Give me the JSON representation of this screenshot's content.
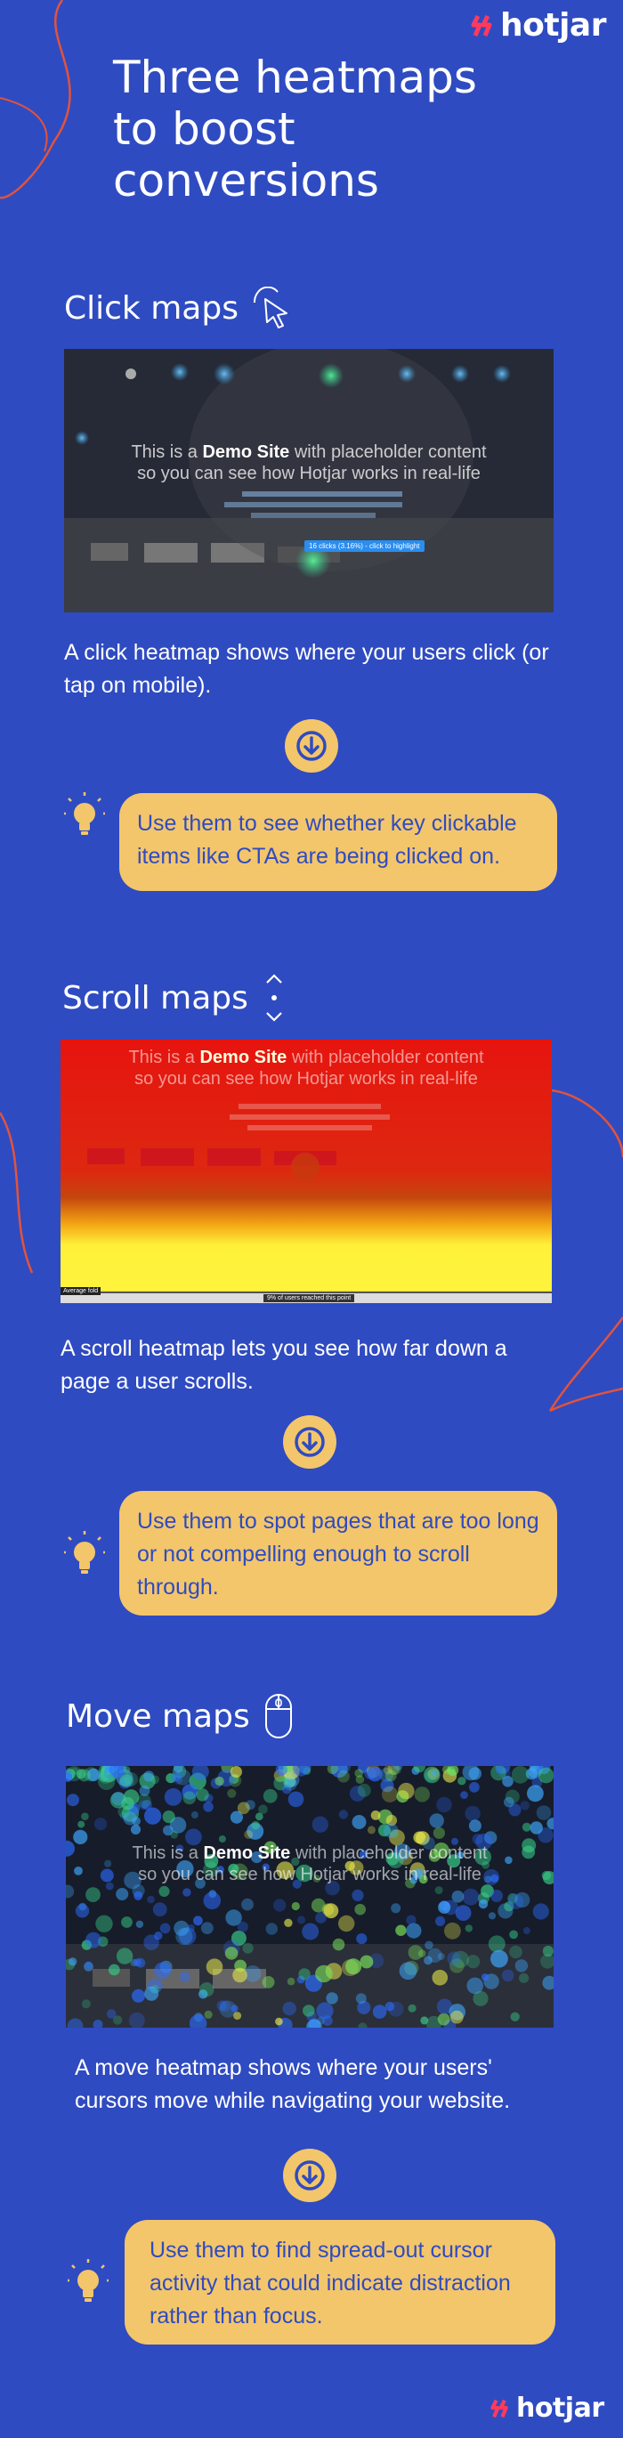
{
  "brand": {
    "name": "hotjar",
    "colors": {
      "background": "#2f4bc1",
      "accent": "#f3c66b",
      "brand": "#fd3a5c"
    }
  },
  "title": {
    "line1": "Three heatmaps",
    "line2": "to boost",
    "line3": "conversions"
  },
  "demo": {
    "prefix": "This is a ",
    "strong": "Demo Site",
    "suffix": " with placeholder content",
    "line2": "so you can see how Hotjar works in real-life"
  },
  "sections": [
    {
      "heading": "Click maps",
      "icon": "cursor-click-icon",
      "body": "A click heatmap shows where your users click (or tap on mobile).",
      "tip": "Use them to see whether key clickable items like CTAs are being clicked on.",
      "badge": "16 clicks (3.16%) - click to highlight"
    },
    {
      "heading": "Scroll maps",
      "icon": "scroll-arrows-icon",
      "body": "A scroll heatmap lets you see how far down a page a user scrolls.",
      "tip": "Use them to spot pages that are too long or not compelling enough to scroll through.",
      "fold_label": "Average fold",
      "badge": "9% of users reached this point"
    },
    {
      "heading": "Move maps",
      "icon": "mouse-icon",
      "body": "A move heatmap shows where your users' cursors move while navigating your website.",
      "tip": "Use them to find spread-out cursor activity that could indicate distraction rather than focus."
    }
  ],
  "icons": {
    "arrow": "arrow-down-circle-icon",
    "bulb": "lightbulb-icon",
    "logo": "hotjar-logo-icon"
  }
}
